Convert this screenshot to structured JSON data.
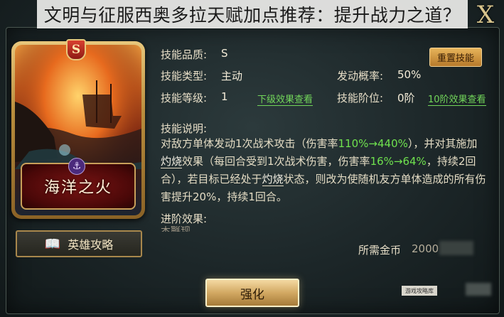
{
  "title_banner": "文明与征服西奥多拉天赋加点推荐：提升战力之道？",
  "close_label": "X",
  "card": {
    "name": "海洋之火",
    "rank": "S"
  },
  "guide_button": "英雄攻略",
  "skill": {
    "quality_label": "技能品质:",
    "quality_value": "S",
    "type_label": "技能类型:",
    "type_value": "主动",
    "level_label": "技能等级:",
    "level_value": "1",
    "next_level_link": "下级效果查看",
    "chance_label": "发动概率:",
    "chance_value": "50%",
    "stage_label": "技能阶位:",
    "stage_value": "0阶",
    "stage10_link": "10阶效果查看",
    "reset_button": "重置技能",
    "desc_label": "技能说明:",
    "desc": {
      "p1": "对敌方单体发动1次战术攻击（伤害率",
      "h1": "110%→440%",
      "p2": "），并对其施加",
      "kw1": "灼烧",
      "p3": "效果（每回合受到1次战术伤害，伤害率",
      "h2": "16%→64%",
      "p4": "，持续2回合），若目标已经处于",
      "kw2": "灼烧",
      "p5": "状态，则改为使随机友方单体造成的所有伤害提升20%，持续1回合。"
    },
    "advanced_label": "进阶效果:",
    "advanced_partial": "未解锁"
  },
  "cost_label": "所需金币",
  "cost_value": "2000",
  "upgrade_button": "强化",
  "watermark": "游戏攻略库"
}
